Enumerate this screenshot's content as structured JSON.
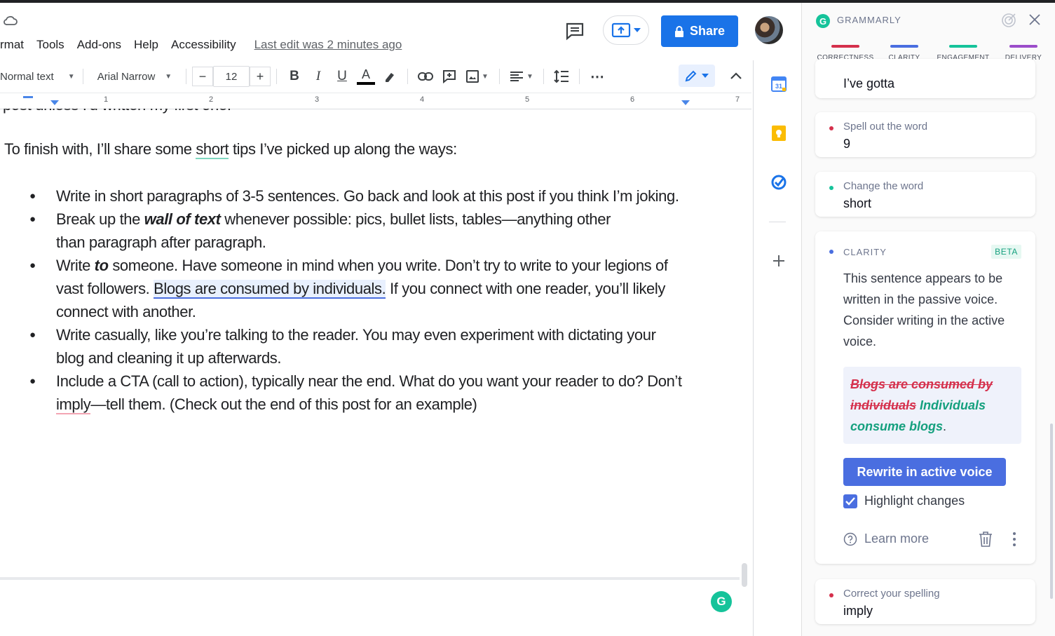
{
  "docs": {
    "menu": [
      "rmat",
      "Tools",
      "Add-ons",
      "Help",
      "Accessibility"
    ],
    "last_edit": "Last edit was 2 minutes ago",
    "share_label": "Share",
    "toolbar": {
      "style": "Normal text",
      "font": "Arial Narrow",
      "font_size": "12",
      "more": "⋯"
    },
    "ruler_numbers": [
      "1",
      "2",
      "3",
      "4",
      "5",
      "6",
      "7"
    ]
  },
  "document": {
    "cut_line": "post unless I'd written my first one.",
    "intro_before": "To finish with, I’ll share some ",
    "intro_flag": "short",
    "intro_after": " tips I’ve picked up along the ways:",
    "bullets": {
      "b1": "Write in short paragraphs of 3-5 sentences. Go back and look at this post if you think I’m joking.",
      "b2_pre": "Break up the ",
      "b2_em": "wall of text",
      "b2_post": " whenever possible: pics, bullet lists, tables—anything other than paragraph after paragraph.",
      "b3_pre": "Write ",
      "b3_em": "to",
      "b3_mid": " someone. Have someone in mind when you write. Don’t try to write to your legions of vast followers. ",
      "b3_hl": "Blogs are consumed by individuals.",
      "b3_post": " If you connect with one reader, you’ll likely connect with another.",
      "b4": "Write casually, like you’re talking to the reader. You may even experiment with dictating your blog and cleaning it up afterwards.",
      "b5_pre": "Include a CTA (call to action), typically near the end. What do you want your reader to do? Don’t ",
      "b5_flag": "imply",
      "b5_post": "—tell them. (Check out the end of this post for an example)"
    }
  },
  "grammarly": {
    "title": "GRAMMARLY",
    "categories": [
      {
        "label": "CORRECTNESS",
        "color": "#d5304c"
      },
      {
        "label": "CLARITY",
        "color": "#4a6ee0"
      },
      {
        "label": "ENGAGEMENT",
        "color": "#15c39a"
      },
      {
        "label": "DELIVERY",
        "color": "#9b4dca"
      }
    ],
    "cards": [
      {
        "label": "",
        "word": "I’ve gotta"
      },
      {
        "label": "Spell out the word",
        "word": "9",
        "dot": "#d5304c"
      },
      {
        "label": "Change the word",
        "word": "short",
        "dot": "#15c39a"
      },
      {
        "label": "Correct your spelling",
        "word": "imply",
        "dot": "#d5304c"
      }
    ],
    "clarity": {
      "heading": "CLARITY",
      "badge": "BETA",
      "message": "This sentence appears to be written in the passive voice. Consider writing in the active voice.",
      "old_text": "Blogs are consumed by individuals",
      "new_text": "Individuals consume blogs",
      "punct": ".",
      "button": "Rewrite in active voice",
      "checkbox_label": "Highlight changes",
      "checkbox_checked": true,
      "learn_more": "Learn more"
    }
  }
}
